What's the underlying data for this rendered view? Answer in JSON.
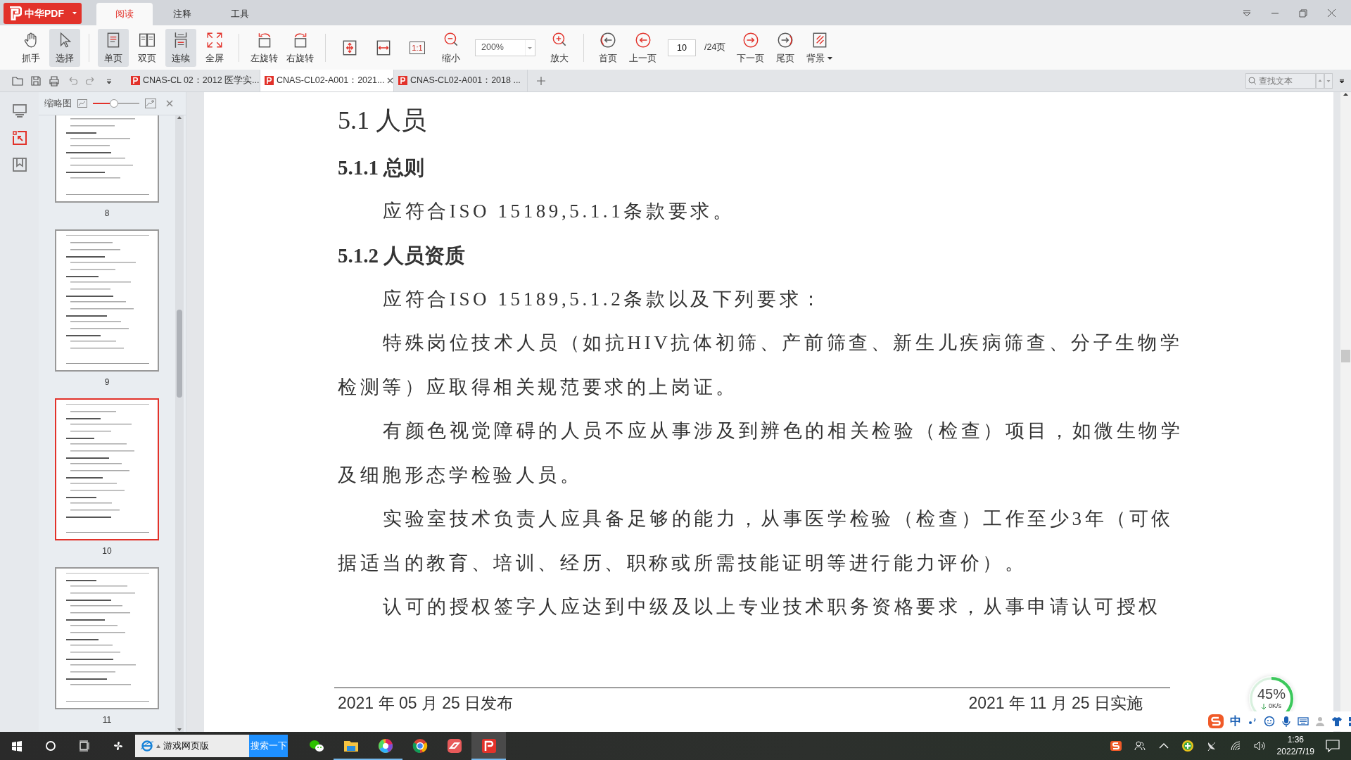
{
  "app": {
    "logo": "中华PDF",
    "menu_tabs": [
      {
        "label": "阅读",
        "selected": true
      },
      {
        "label": "注释",
        "selected": false
      },
      {
        "label": "工具",
        "selected": false
      }
    ]
  },
  "toolbar": [
    {
      "kind": "button",
      "label": "抓手",
      "selected": false
    },
    {
      "kind": "button",
      "label": "选择",
      "selected": true
    },
    {
      "kind": "separator"
    },
    {
      "kind": "button",
      "label": "单页",
      "selected": true
    },
    {
      "kind": "button",
      "label": "双页",
      "selected": false
    },
    {
      "kind": "button",
      "label": "连续",
      "selected": true
    },
    {
      "kind": "button",
      "label": "全屏",
      "selected": false
    },
    {
      "kind": "separator"
    },
    {
      "kind": "button",
      "label": "左旋转",
      "selected": false
    },
    {
      "kind": "button",
      "label": "右旋转",
      "selected": false
    },
    {
      "kind": "separator"
    },
    {
      "kind": "icon",
      "selected": false
    },
    {
      "kind": "icon",
      "selected": false
    },
    {
      "kind": "glyph",
      "glyph": "1:1",
      "selected": false
    },
    {
      "kind": "button",
      "label": "缩小",
      "selected": false
    },
    {
      "kind": "zoom",
      "value": "200%"
    },
    {
      "kind": "button",
      "label": "放大",
      "selected": false
    },
    {
      "kind": "separator"
    },
    {
      "kind": "button",
      "label": "首页",
      "selected": false
    },
    {
      "kind": "button",
      "label": "上一页",
      "selected": false
    },
    {
      "kind": "page",
      "value": "10"
    },
    {
      "kind": "text",
      "label": "/24页"
    },
    {
      "kind": "button",
      "label": "下一页",
      "selected": false
    },
    {
      "kind": "button",
      "label": "尾页",
      "selected": false
    },
    {
      "kind": "menu",
      "label": "背景",
      "selected": false
    }
  ],
  "doc_tabs": [
    {
      "title": "CNAS-CL 02：2012 医学实...",
      "selected": false
    },
    {
      "title": "CNAS-CL02-A001：2021...",
      "selected": true
    },
    {
      "title": "CNAS-CL02-A001：2018 ...",
      "selected": false
    }
  ],
  "search": {
    "placeholder": "查找文本"
  },
  "thumbnails": {
    "title": "缩略图",
    "level": 0.45,
    "pages": [
      {
        "label": "8",
        "selected": false
      },
      {
        "label": "9",
        "selected": false
      },
      {
        "label": "10",
        "selected": true
      },
      {
        "label": "11",
        "selected": false
      }
    ]
  },
  "document": {
    "blocks": [
      {
        "kind": "h1",
        "text": "5.1  人员"
      },
      {
        "kind": "h2",
        "text": "5.1.1 总则"
      },
      {
        "kind": "para",
        "text": "应符合ISO 15189,5.1.1条款要求。"
      },
      {
        "kind": "h2",
        "text": "5.1.2 人员资质"
      },
      {
        "kind": "para",
        "text": "应符合ISO 15189,5.1.2条款以及下列要求："
      },
      {
        "kind": "para",
        "text": "特殊岗位技术人员（如抗HIV抗体初筛、产前筛查、新生儿疾病筛查、分子生物学检测等）应取得相关规范要求的上岗证。"
      },
      {
        "kind": "para",
        "text": "有颜色视觉障碍的人员不应从事涉及到辨色的相关检验（检查）项目，如微生物学及细胞形态学检验人员。"
      },
      {
        "kind": "para",
        "text": "实验室技术负责人应具备足够的能力，从事医学检验（检查）工作至少3年（可依据适当的教育、培训、经历、职称或所需技能证明等进行能力评价）。"
      },
      {
        "kind": "para",
        "text": "认可的授权签字人应达到中级及以上专业技术职务资格要求，从事申请认可授权"
      }
    ],
    "footer": {
      "left": "2021 年 05 月 25 日发布",
      "right": "2021 年 11 月 25 日实施"
    }
  },
  "meter": {
    "level": 0.45,
    "percent": "45%",
    "speed": "0K/s"
  },
  "ime": {
    "mode": "中"
  },
  "taskbar": {
    "search": "游戏网页版",
    "search_button": "搜索一下",
    "apps": [
      {
        "running": false,
        "selected": false
      },
      {
        "running": true,
        "selected": false
      },
      {
        "running": true,
        "selected": false
      },
      {
        "running": false,
        "selected": false
      },
      {
        "running": false,
        "selected": false
      },
      {
        "running": true,
        "selected": true
      }
    ],
    "time": "1:36",
    "date": "2022/7/19"
  }
}
